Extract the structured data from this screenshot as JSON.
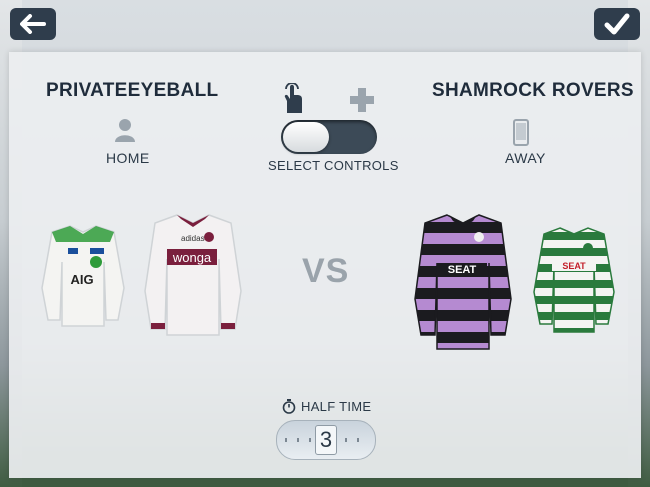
{
  "home": {
    "name": "PRIVATEEYEBALL",
    "side": "HOME",
    "icon": "person-icon",
    "kits": [
      {
        "colors": {
          "body": "#f4f4f2",
          "trim": "#2e9b3a",
          "accent": "#1a4f9c"
        },
        "sponsor": "AIG"
      },
      {
        "colors": {
          "body": "#f3f1f2",
          "trim": "#7a1f3d",
          "accent": "#7a1f3d"
        },
        "sponsor": "wonga"
      }
    ]
  },
  "away": {
    "name": "SHAMROCK ROVERS",
    "side": "AWAY",
    "icon": "tablet-icon",
    "kits": [
      {
        "colors": {
          "stripeA": "#b58ad1",
          "stripeB": "#1b1b1f",
          "trim": "#1b1b1f"
        },
        "sponsor": "SEAT"
      },
      {
        "colors": {
          "stripeA": "#f4f4f2",
          "stripeB": "#2a7a3d",
          "trim": "#2a7a3d"
        },
        "sponsor": "SEAT"
      }
    ]
  },
  "controls": {
    "label": "SELECT CONTROLS",
    "left_icon": "touch-icon",
    "right_icon": "gamepad-icon",
    "selected": "touch"
  },
  "vs_label": "VS",
  "half_time": {
    "label": "HALF TIME",
    "value": "3",
    "icon": "stopwatch-icon"
  },
  "nav": {
    "back_icon": "back-arrow-icon",
    "confirm_icon": "checkmark-icon"
  },
  "colors": {
    "dark": "#2f3d4c",
    "text": "#1f2c3b"
  }
}
